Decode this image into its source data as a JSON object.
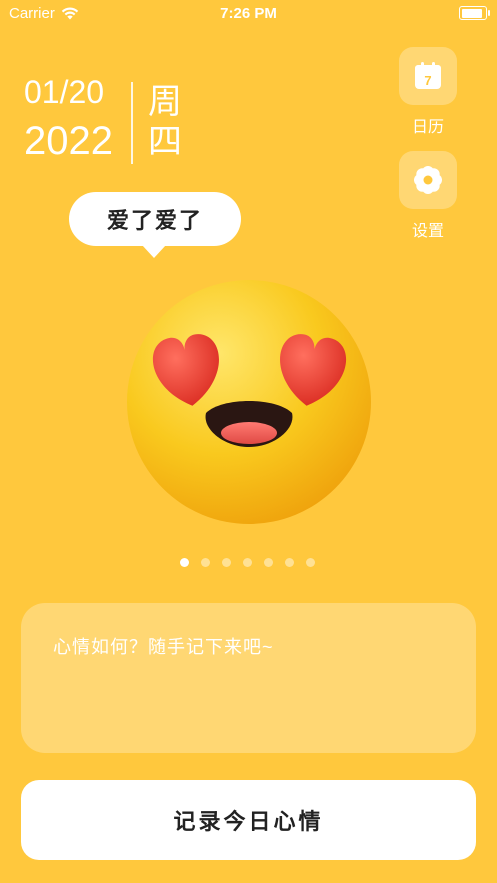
{
  "status_bar": {
    "carrier": "Carrier",
    "time": "7:26 PM",
    "battery_level": 1.0
  },
  "date": {
    "month_day": "01/20",
    "year": "2022",
    "weekday": "周四"
  },
  "calendar": {
    "label": "日历",
    "icon": "calendar-icon",
    "icon_day": "7"
  },
  "settings": {
    "label": "设置",
    "icon": "gear-icon"
  },
  "mood": {
    "bubble_text": "爱了爱了",
    "emoji": "heart-eyes-emoji"
  },
  "pager": {
    "count": 7,
    "active_index": 0
  },
  "note": {
    "placeholder": "心情如何？随手记下来吧~"
  },
  "record_button": {
    "label": "记录今日心情"
  },
  "colors": {
    "background": "#FFC83D",
    "heart": "#E83A2E",
    "card": "#FFFFFF"
  }
}
